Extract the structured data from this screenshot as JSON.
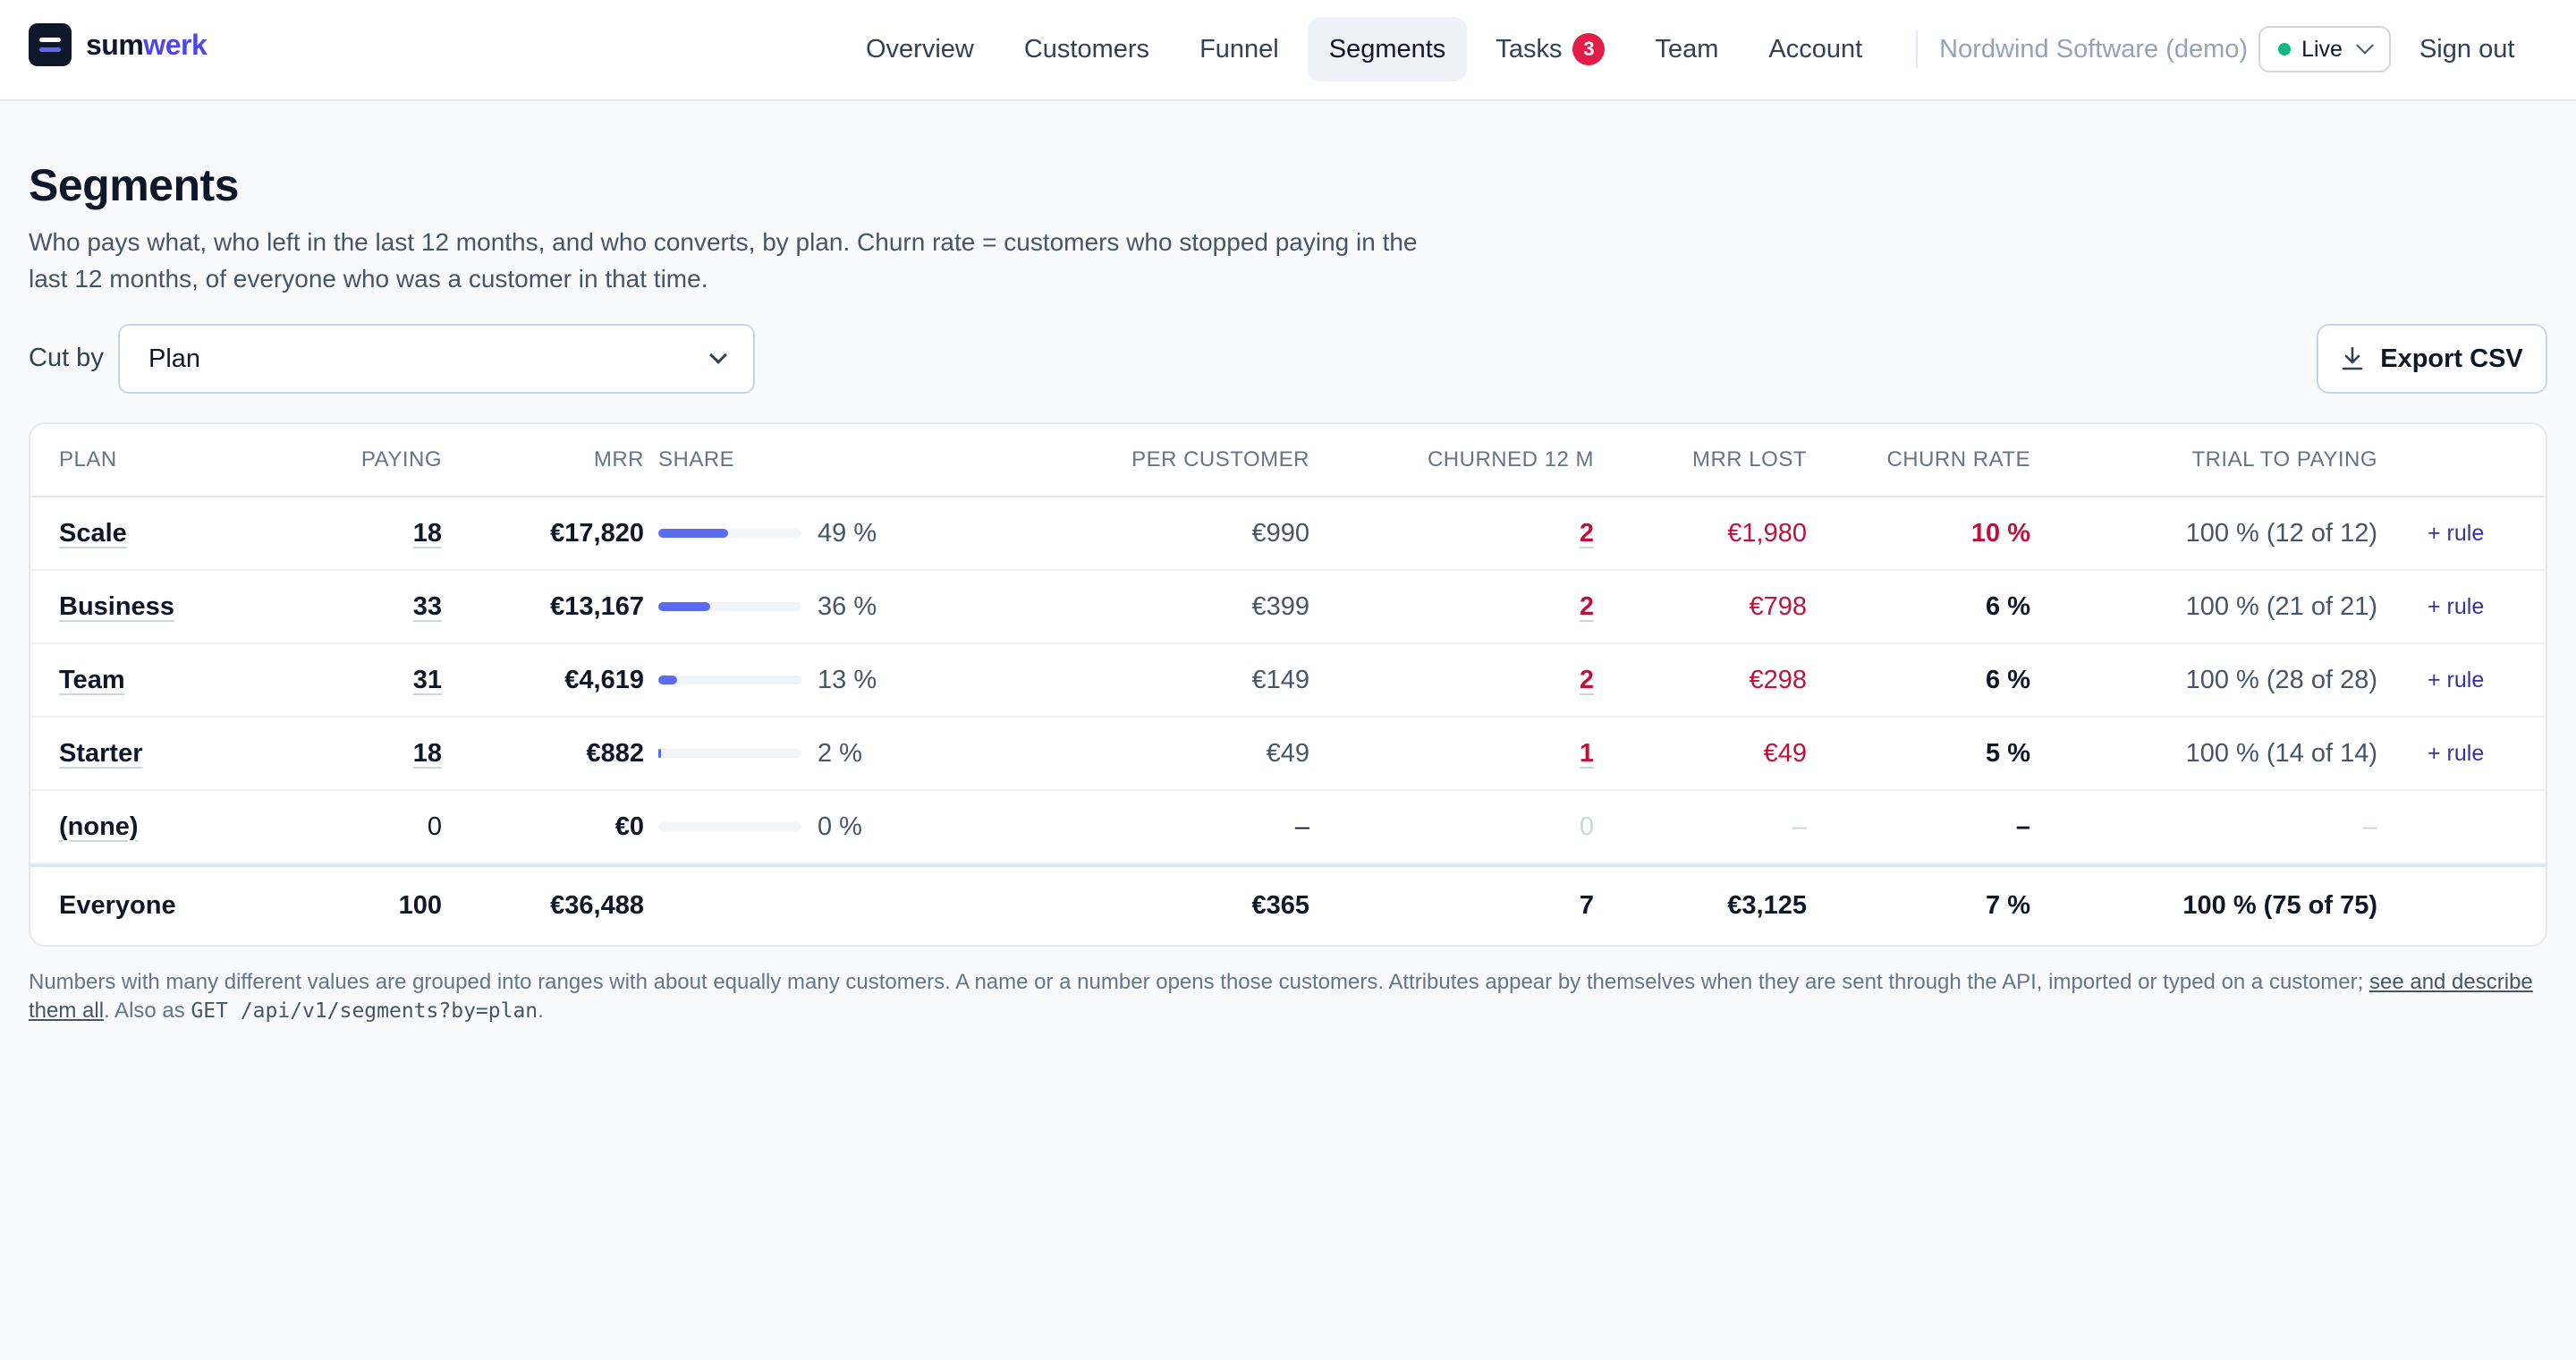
{
  "brand": {
    "part1": "sum",
    "part2": "werk"
  },
  "nav": {
    "items": [
      {
        "label": "Overview",
        "key": "overview"
      },
      {
        "label": "Customers",
        "key": "customers"
      },
      {
        "label": "Funnel",
        "key": "funnel"
      },
      {
        "label": "Segments",
        "key": "segments",
        "active": true
      },
      {
        "label": "Tasks",
        "key": "tasks",
        "badge": "3"
      },
      {
        "label": "Team",
        "key": "team"
      },
      {
        "label": "Account",
        "key": "account"
      }
    ],
    "org": "Nordwind Software (demo)",
    "env": "Live",
    "sign_out": "Sign out"
  },
  "page": {
    "title": "Segments",
    "description": "Who pays what, who left in the last 12 months, and who converts, by plan. Churn rate = customers who stopped paying in the last 12 months, of everyone who was a customer in that time."
  },
  "controls": {
    "cut_by_label": "Cut by",
    "cut_by_value": "Plan",
    "export_label": "Export CSV"
  },
  "colors": {
    "accent": "#5b6cf0",
    "danger": "#be123c",
    "live": "#10b981"
  },
  "table": {
    "headers": {
      "plan": "PLAN",
      "paying": "PAYING",
      "mrr": "MRR",
      "share": "SHARE",
      "per_customer": "PER CUSTOMER",
      "churned": "CHURNED 12 M",
      "mrr_lost": "MRR LOST",
      "churn_rate": "CHURN RATE",
      "trial": "TRIAL TO PAYING"
    },
    "rows": [
      {
        "plan": "Scale",
        "paying": "18",
        "mrr": "€17,820",
        "share": 0.49,
        "share_label": "49 %",
        "per_customer": "€990",
        "churned": "2",
        "mrr_lost": "€1,980",
        "churn_rate": "10 %",
        "trial": "100 % (12 of 12)",
        "rule": "+ rule"
      },
      {
        "plan": "Business",
        "paying": "33",
        "mrr": "€13,167",
        "share": 0.36,
        "share_label": "36 %",
        "per_customer": "€399",
        "churned": "2",
        "mrr_lost": "€798",
        "churn_rate": "6 %",
        "trial": "100 % (21 of 21)",
        "rule": "+ rule"
      },
      {
        "plan": "Team",
        "paying": "31",
        "mrr": "€4,619",
        "share": 0.13,
        "share_label": "13 %",
        "per_customer": "€149",
        "churned": "2",
        "mrr_lost": "€298",
        "churn_rate": "6 %",
        "trial": "100 % (28 of 28)",
        "rule": "+ rule"
      },
      {
        "plan": "Starter",
        "paying": "18",
        "mrr": "€882",
        "share": 0.02,
        "share_label": "2 %",
        "per_customer": "€49",
        "churned": "1",
        "mrr_lost": "€49",
        "churn_rate": "5 %",
        "trial": "100 % (14 of 14)",
        "rule": "+ rule"
      },
      {
        "plan": "(none)",
        "paying": "0",
        "mrr": "€0",
        "share": 0.0,
        "share_label": "0 %",
        "per_customer": "–",
        "churned": "0",
        "mrr_lost": "–",
        "churn_rate": "–",
        "trial": "–",
        "rule": ""
      }
    ],
    "total": {
      "plan": "Everyone",
      "paying": "100",
      "mrr": "€36,488",
      "per_customer": "€365",
      "churned": "7",
      "mrr_lost": "€3,125",
      "churn_rate": "7 %",
      "trial": "100 % (75 of 75)"
    }
  },
  "footnote": {
    "text": "Numbers with many different values are grouped into ranges with about equally many customers. A name or a number opens those customers. Attributes appear by themselves when they are sent through the API, imported or typed on a customer; ",
    "link": "see and describe them all",
    "after_link": ". Also as ",
    "code": "GET /api/v1/segments?by=plan",
    "end": "."
  }
}
